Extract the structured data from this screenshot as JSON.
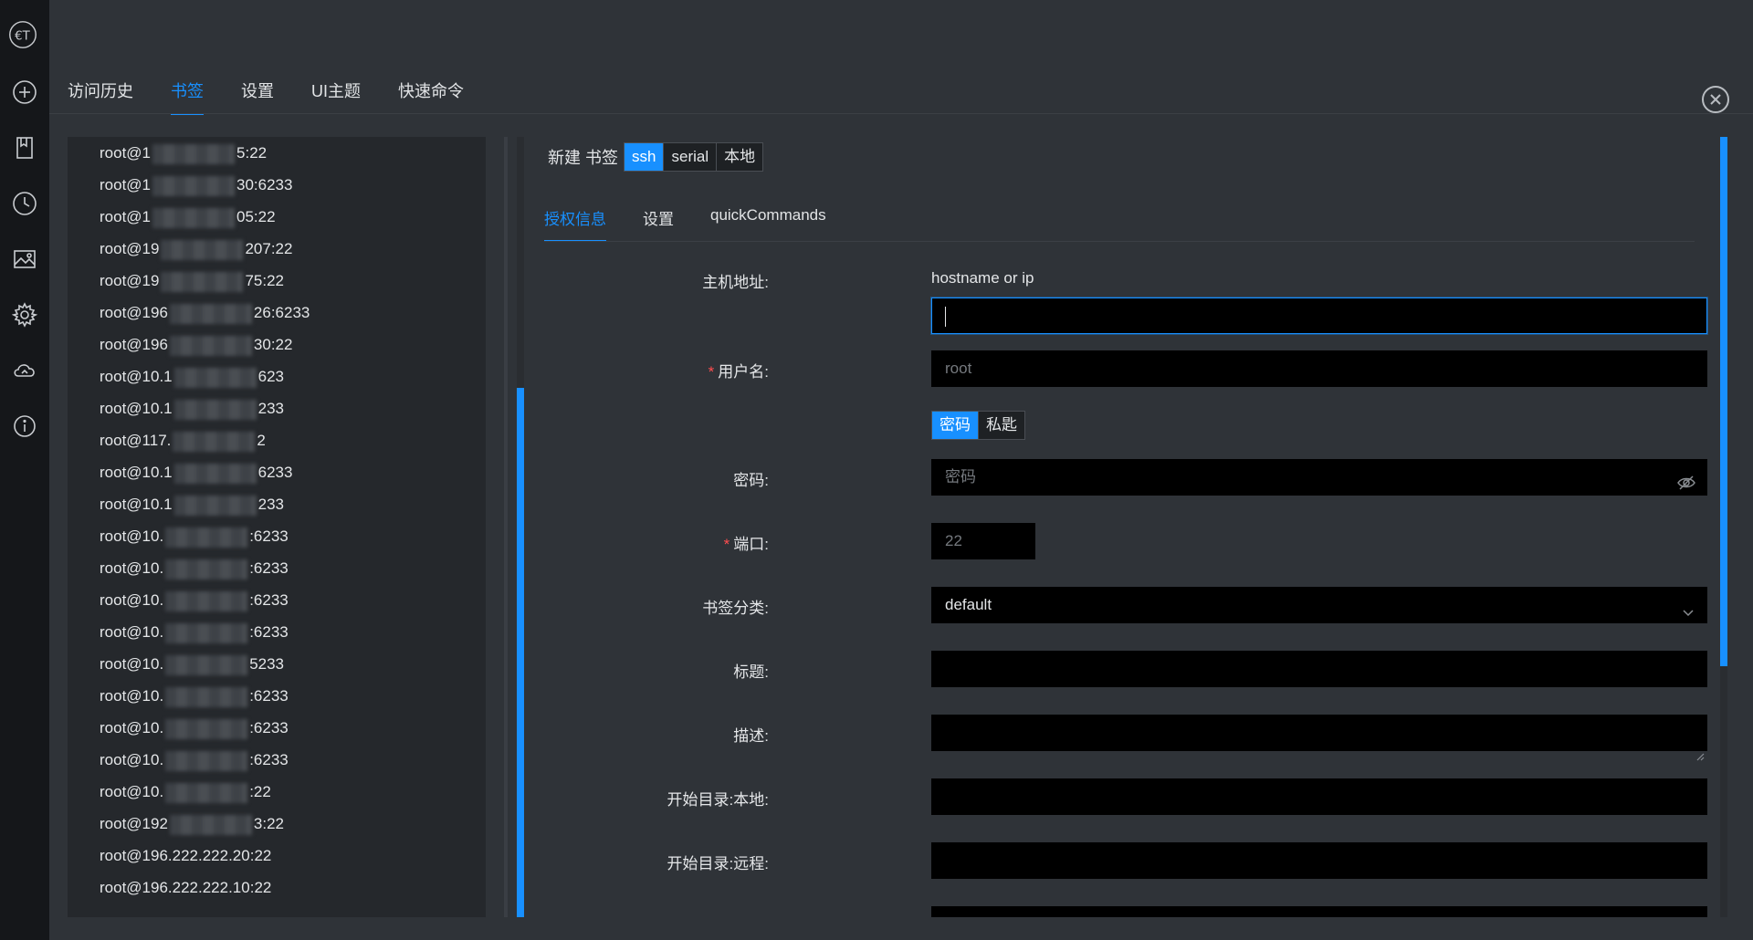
{
  "top_tabs": [
    {
      "label": "访问历史"
    },
    {
      "label": "书签"
    },
    {
      "label": "设置"
    },
    {
      "label": "UI主题"
    },
    {
      "label": "快速命令"
    }
  ],
  "bookmarks": [
    {
      "prefix": "root@1",
      "suffix": "5:22"
    },
    {
      "prefix": "root@1",
      "suffix": "30:6233"
    },
    {
      "prefix": "root@1",
      "suffix": "05:22"
    },
    {
      "prefix": "root@19",
      "suffix": "207:22"
    },
    {
      "prefix": "root@19",
      "suffix": "75:22"
    },
    {
      "prefix": "root@196",
      "suffix": "26:6233"
    },
    {
      "prefix": "root@196",
      "suffix": "30:22"
    },
    {
      "prefix": "root@10.1",
      "suffix": "623"
    },
    {
      "prefix": "root@10.1",
      "suffix": "233"
    },
    {
      "prefix": "root@117.",
      "suffix": "2"
    },
    {
      "prefix": "root@10.1",
      "suffix": "6233"
    },
    {
      "prefix": "root@10.1",
      "suffix": "233"
    },
    {
      "prefix": "root@10.",
      "suffix": ":6233"
    },
    {
      "prefix": "root@10.",
      "suffix": ":6233"
    },
    {
      "prefix": "root@10.",
      "suffix": ":6233"
    },
    {
      "prefix": "root@10.",
      "suffix": ":6233"
    },
    {
      "prefix": "root@10.",
      "suffix": "5233"
    },
    {
      "prefix": "root@10.",
      "suffix": ":6233"
    },
    {
      "prefix": "root@10.",
      "suffix": ":6233"
    },
    {
      "prefix": "root@10.",
      "suffix": ":6233"
    },
    {
      "prefix": "root@10.",
      "suffix": ":22"
    },
    {
      "prefix": "root@192",
      "suffix": "3:22"
    },
    {
      "prefix": "root@196.222.222.20:22",
      "suffix": ""
    },
    {
      "prefix": "root@196.222.222.10:22",
      "suffix": ""
    }
  ],
  "form": {
    "new_label": "新建 书签",
    "types": [
      "ssh",
      "serial",
      "本地"
    ],
    "selected_type": "ssh",
    "sub_tabs": [
      "授权信息",
      "设置",
      "quickCommands"
    ],
    "host_label": "主机地址:",
    "host_hint": "hostname or ip",
    "username_label": "用户名:",
    "username_placeholder": "root",
    "auth_types": [
      "密码",
      "私匙"
    ],
    "password_label": "密码:",
    "password_placeholder": "密码",
    "port_label": "端口:",
    "port_value": "22",
    "category_label": "书签分类:",
    "category_value": "default",
    "title_label": "标题:",
    "description_label": "描述:",
    "local_dir_label": "开始目录:本地:",
    "remote_dir_label": "开始目录:远程:"
  },
  "icons": [
    "logo-icon",
    "add-icon",
    "bookmark-icon",
    "history-icon",
    "image-icon",
    "gear-icon",
    "cloud-sync-icon",
    "info-icon",
    "close-icon",
    "eye-off-icon",
    "chevron-down-icon"
  ],
  "colors": {
    "accent": "#1890ff",
    "required": "#ff4d4f",
    "bg": "#2f3338",
    "iconbar": "#15171a"
  }
}
